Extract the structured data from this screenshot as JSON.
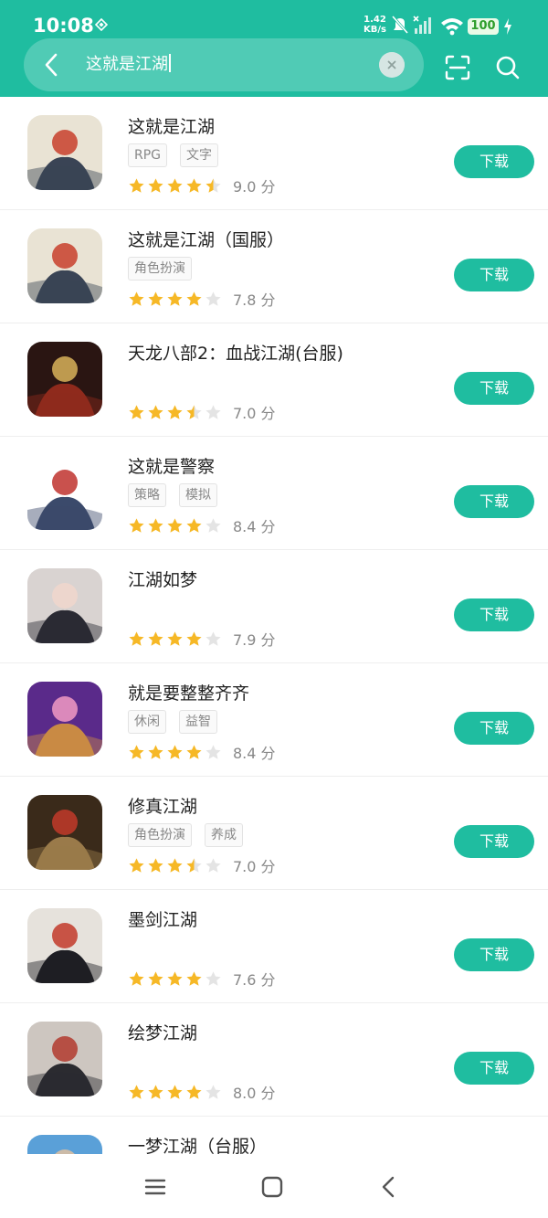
{
  "status_bar": {
    "time": "10:08",
    "net_speed_value": "1.42",
    "net_speed_unit": "KB/s",
    "battery": "100"
  },
  "search": {
    "query": "这就是江湖"
  },
  "results": [
    {
      "title": "这就是江湖",
      "tags": [
        "RPG",
        "文字"
      ],
      "stars": [
        1,
        1,
        1,
        1,
        0.5
      ],
      "score": "9.0 分",
      "button": "下载",
      "icon_colors": [
        "#e9e3d4",
        "#3a4455",
        "#c8402c"
      ]
    },
    {
      "title": "这就是江湖（国服）",
      "tags": [
        "角色扮演"
      ],
      "stars": [
        1,
        1,
        1,
        1,
        0
      ],
      "score": "7.8 分",
      "button": "下载",
      "icon_colors": [
        "#e9e3d4",
        "#3a4455",
        "#c8402c"
      ]
    },
    {
      "title": "天龙八部2：血战江湖(台服)",
      "tags": [],
      "stars": [
        1,
        1,
        1,
        0.5,
        0
      ],
      "score": "7.0 分",
      "button": "下载",
      "icon_colors": [
        "#2a1512",
        "#8f2a1c",
        "#d8b15a"
      ]
    },
    {
      "title": "这就是警察",
      "tags": [
        "策略",
        "模拟"
      ],
      "stars": [
        1,
        1,
        1,
        1,
        0
      ],
      "score": "8.4 分",
      "button": "下载",
      "icon_colors": [
        "#ffffff",
        "#3b4a6b",
        "#c0332e"
      ]
    },
    {
      "title": "江湖如梦",
      "tags": [],
      "stars": [
        1,
        1,
        1,
        1,
        0
      ],
      "score": "7.9 分",
      "button": "下载",
      "icon_colors": [
        "#d9d3d1",
        "#2a2a33",
        "#f0d6cc"
      ]
    },
    {
      "title": "就是要整整齐齐",
      "tags": [
        "休闲",
        "益智"
      ],
      "stars": [
        1,
        1,
        1,
        1,
        0
      ],
      "score": "8.4 分",
      "button": "下载",
      "icon_colors": [
        "#5a2a8a",
        "#c98a44",
        "#f29ac3"
      ]
    },
    {
      "title": "修真江湖",
      "tags": [
        "角色扮演",
        "养成"
      ],
      "stars": [
        1,
        1,
        1,
        0.5,
        0
      ],
      "score": "7.0 分",
      "button": "下载",
      "icon_colors": [
        "#3a2a1a",
        "#9a7a4a",
        "#c23a2a"
      ]
    },
    {
      "title": "墨剑江湖",
      "tags": [],
      "stars": [
        1,
        1,
        1,
        1,
        0
      ],
      "score": "7.6 分",
      "button": "下载",
      "icon_colors": [
        "#e6e2dc",
        "#1e1e24",
        "#c23a2a"
      ]
    },
    {
      "title": "绘梦江湖",
      "tags": [],
      "stars": [
        1,
        1,
        1,
        1,
        0
      ],
      "score": "8.0 分",
      "button": "下载",
      "icon_colors": [
        "#cdc6c0",
        "#2b2b30",
        "#b23a2e"
      ]
    },
    {
      "title": "一梦江湖（台服）",
      "tags": [],
      "stars": [],
      "score": "",
      "button": "",
      "icon_colors": [
        "#5aa0d8",
        "#2a3a5a",
        "#e0c0a0"
      ]
    }
  ],
  "colors": {
    "accent": "#1fbda0",
    "star": "#f6b826",
    "star_empty": "#e4e4e4"
  },
  "icons": {
    "back": "chevron-left-icon",
    "clear": "close-icon",
    "scan": "scan-icon",
    "search": "search-icon",
    "nav_menu": "menu-icon",
    "nav_home": "home-square-icon",
    "nav_back": "back-icon"
  }
}
